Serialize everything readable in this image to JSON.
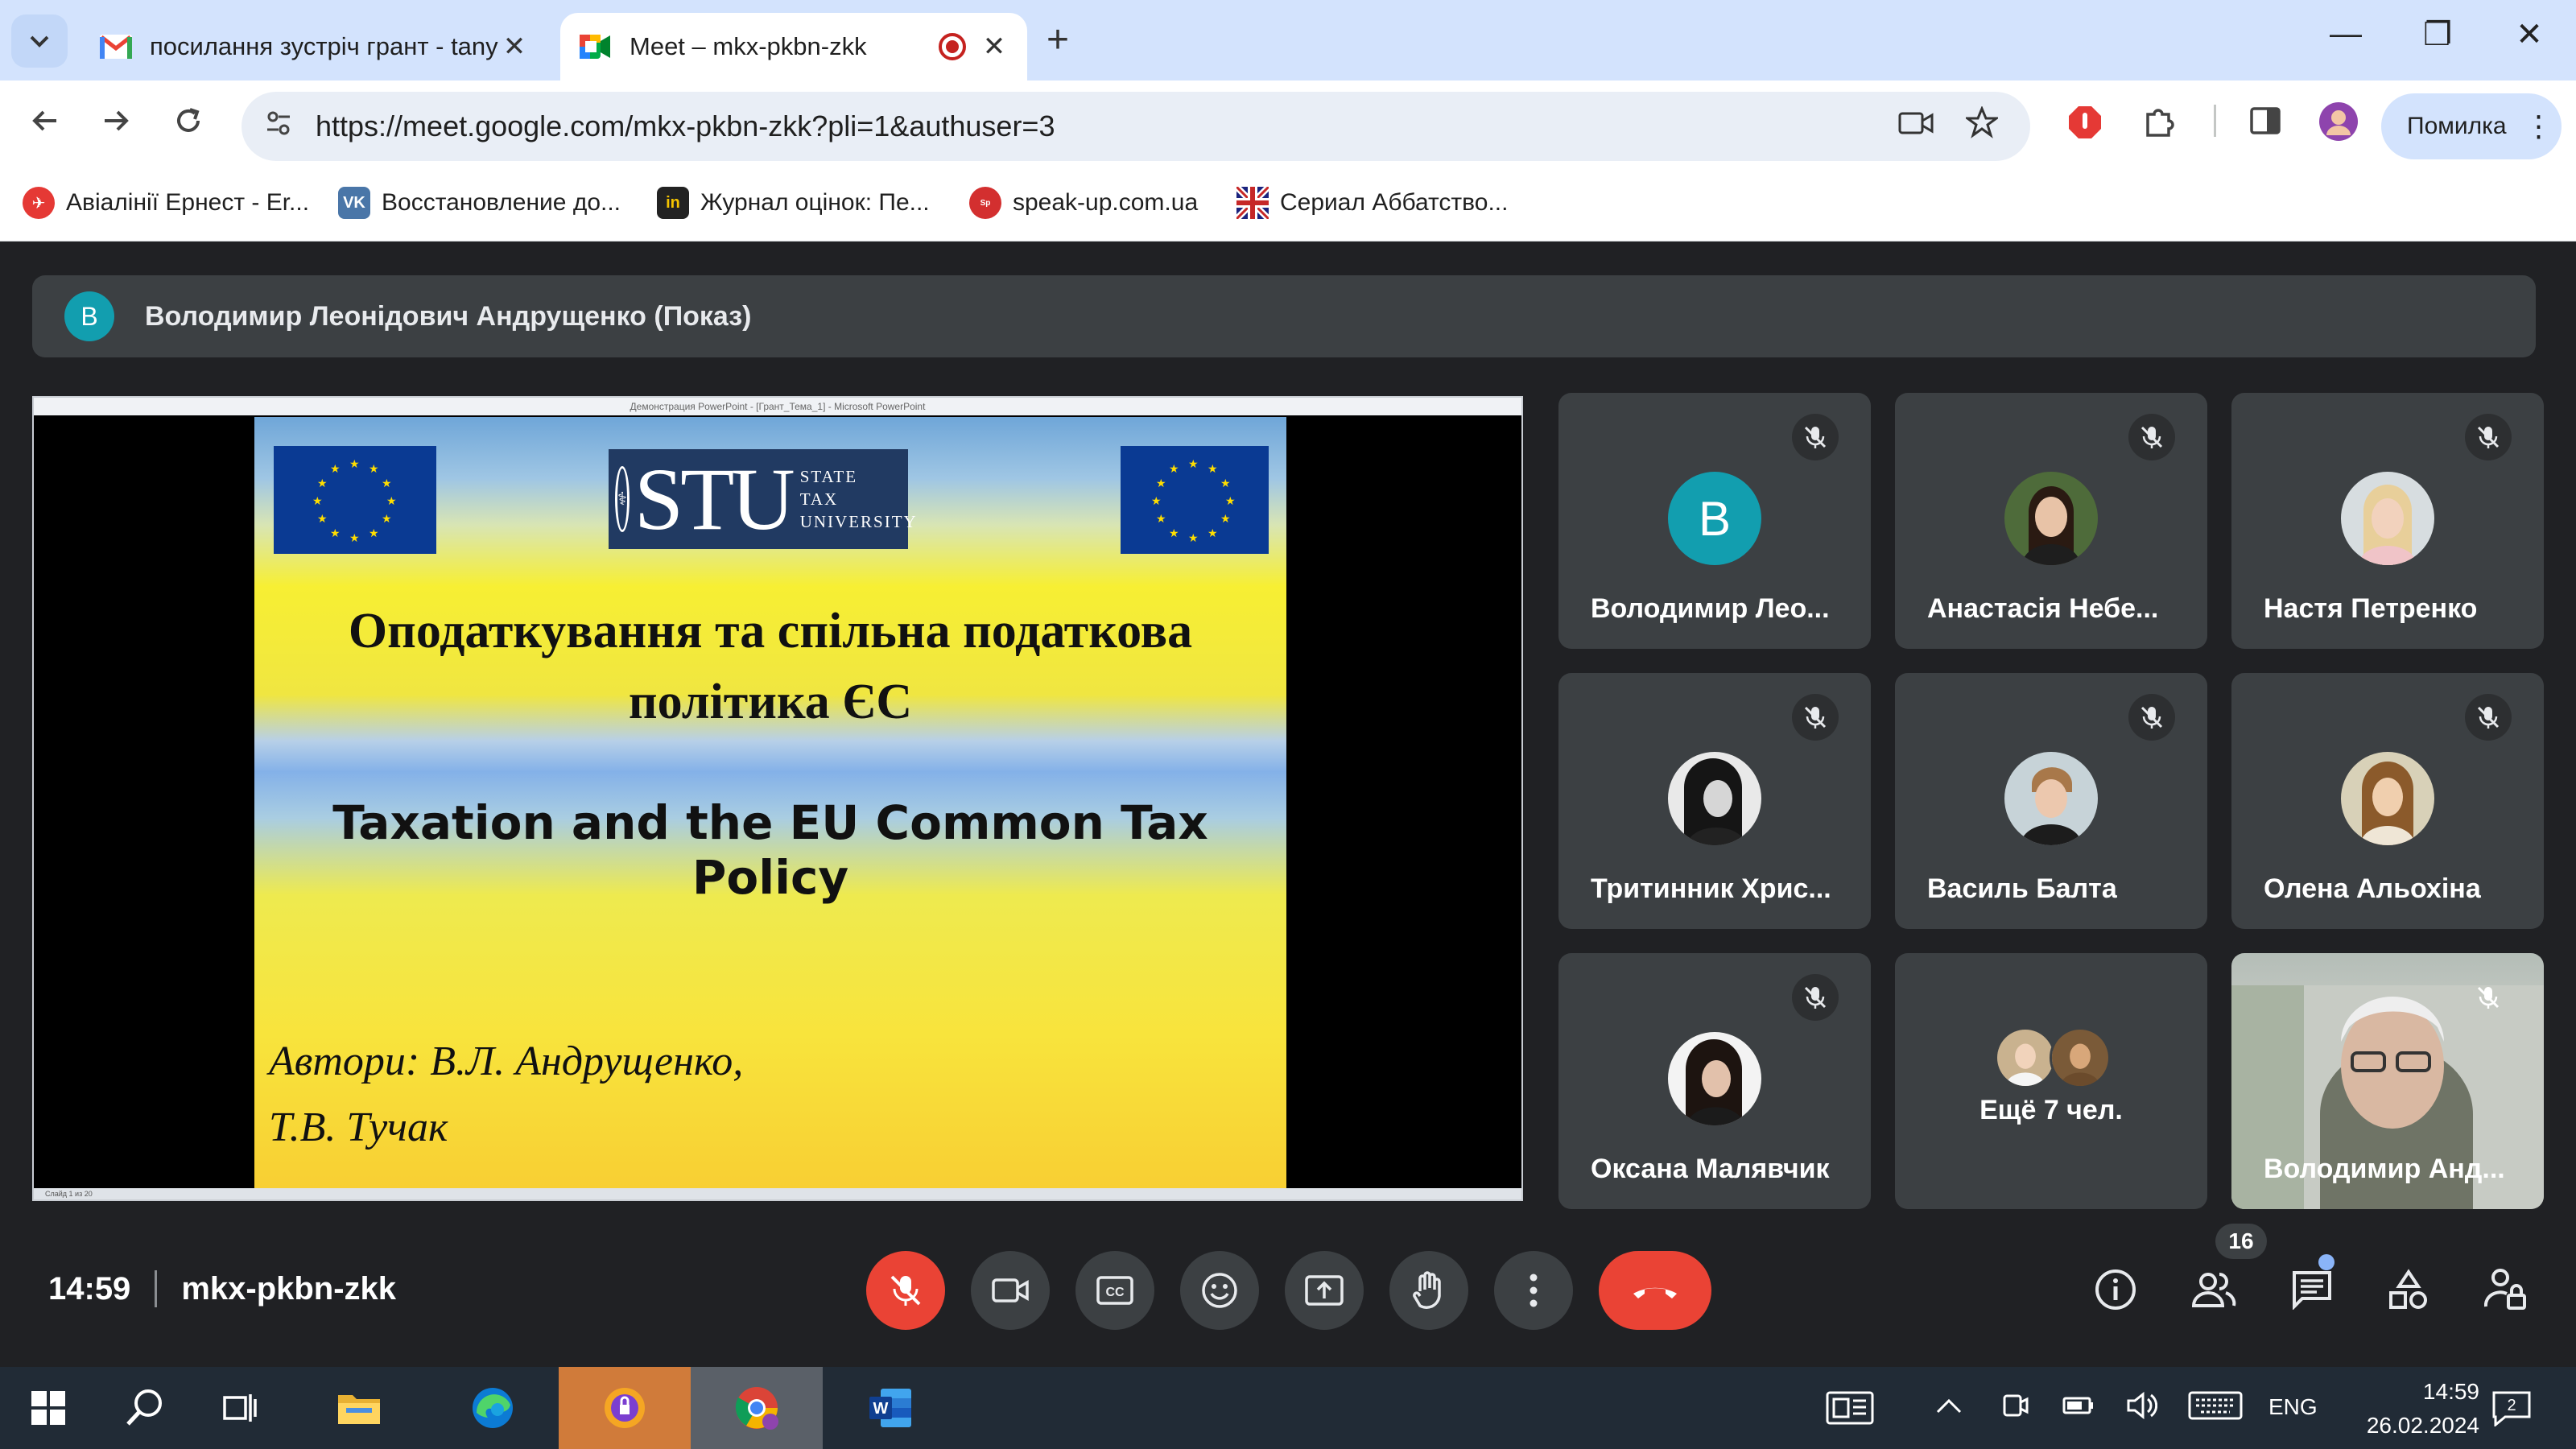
{
  "browser": {
    "tabs": [
      {
        "title": "посилання зустріч грант - tany",
        "close": "✕"
      },
      {
        "title": "Meet – mkx-pkbn-zkk",
        "close": "✕"
      }
    ],
    "new_tab": "+",
    "window_controls": {
      "minimize": "—",
      "restore": "❐",
      "close": "✕"
    },
    "url": "https://meet.google.com/mkx-pkbn-zkk?pli=1&authuser=3",
    "profile_label": "Помилка",
    "bookmarks": [
      {
        "label": "Авіалінії Ернест - Er...",
        "color": "#e53935"
      },
      {
        "label": "Восстановление до...",
        "color": "#4a76a8"
      },
      {
        "label": "Журнал оцінок: Пе...",
        "color": "#222222"
      },
      {
        "label": "speak-up.com.ua",
        "color": "#d32f2f"
      },
      {
        "label": "Сериал Аббатство...",
        "color": "#1a237e"
      }
    ]
  },
  "meet": {
    "presenter": {
      "initial": "В",
      "name": "Володимир Леонідович Андрущенко (Показ)"
    },
    "powerpoint": {
      "titlebar": "Демонстрация PowerPoint - [Грант_Тема_1] - Microsoft PowerPoint",
      "status": "Слайд 1 из 20"
    },
    "slide": {
      "logo_big": "STU",
      "logo_lines": [
        "STATE",
        "TAX",
        "UNIVERSITY"
      ],
      "title_uk_line1": "Оподаткування та спільна податкова",
      "title_uk_line2": "політика ЄС",
      "title_en": "Taxation and the EU Common Tax Policy",
      "authors_line1": "Автори: В.Л. Андрущенко,",
      "authors_line2": "Т.В. Тучак"
    },
    "participants": [
      {
        "name": "Володимир Лео...",
        "initial": "В"
      },
      {
        "name": "Анастасія Небе..."
      },
      {
        "name": "Настя Петренко"
      },
      {
        "name": "Тритинник Хрис..."
      },
      {
        "name": "Василь Балта"
      },
      {
        "name": "Олена Альохіна"
      },
      {
        "name": "Оксана Малявчик"
      },
      {
        "name": "Ещё 7 чел."
      },
      {
        "name": "Володимир Анд..."
      }
    ],
    "meeting_time": "14:59",
    "meeting_code": "mkx-pkbn-zkk",
    "people_count": "16"
  },
  "taskbar": {
    "lang": "ENG",
    "time": "14:59",
    "date": "26.02.2024",
    "notifications": "2"
  },
  "colors": {
    "meet_bg": "#202124",
    "tile_bg": "#3c4043",
    "red": "#ea4335",
    "chrome_tabbar": "#d3e3fd"
  }
}
